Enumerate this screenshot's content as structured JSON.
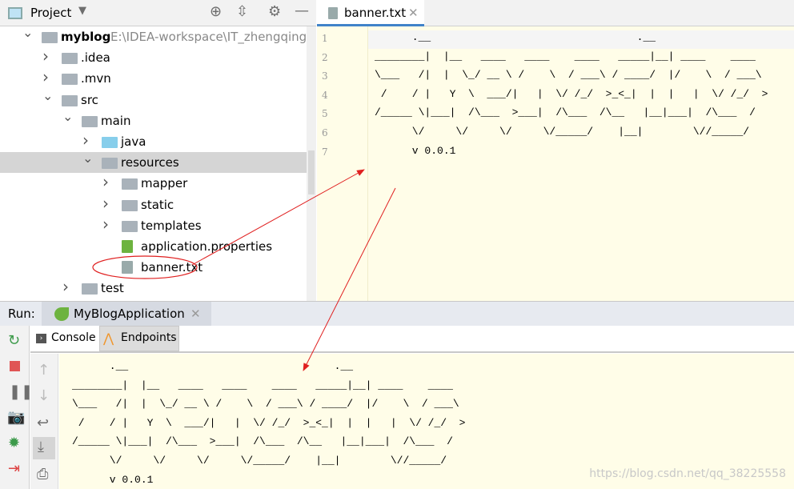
{
  "project_panel": {
    "title": "Project",
    "icons": [
      "project-view-icon",
      "chevron-down-icon",
      "locate-icon",
      "collapse-all-icon",
      "gear-icon",
      "minimize-icon"
    ]
  },
  "tree": [
    {
      "label": "myblog",
      "path": "E:\\IDEA-workspace\\IT_zhengqing\\test\\",
      "expanded": true
    },
    {
      "label": ".idea",
      "expanded": false
    },
    {
      "label": ".mvn",
      "expanded": false
    },
    {
      "label": "src",
      "expanded": true
    },
    {
      "label": "main",
      "expanded": true
    },
    {
      "label": "java",
      "expanded": false
    },
    {
      "label": "resources",
      "expanded": true,
      "selected": true
    },
    {
      "label": "mapper",
      "expanded": false
    },
    {
      "label": "static",
      "expanded": false
    },
    {
      "label": "templates",
      "expanded": false
    },
    {
      "label": "application.properties"
    },
    {
      "label": "banner.txt",
      "highlighted": true
    },
    {
      "label": "test",
      "expanded": false
    }
  ],
  "editor": {
    "tab": "banner.txt",
    "line_numbers": [
      "1",
      "2",
      "3",
      "4",
      "5",
      "6",
      "7"
    ],
    "lines": [
      "      .__                                 .__",
      "________|  |__   ____   ____    ____   _____|__| ____    ____",
      "\\___   /|  |  \\_/ __ \\ /    \\  / ___\\ / ____/  |/    \\  / ___\\",
      " /    / |   Y  \\  ___/|   |  \\/ /_/  >_<_|  |  |   |  \\/ /_/  >",
      "/_____ \\|___|  /\\___  >___|  /\\___  /\\__   |__|___|  /\\___  /",
      "      \\/     \\/     \\/     \\/_____/    |__|        \\//_____/",
      "      v 0.0.1"
    ]
  },
  "run": {
    "label": "Run:",
    "tab": "MyBlogApplication",
    "subtabs": [
      "Console",
      "Endpoints"
    ],
    "left_toolbar": [
      "rerun-icon",
      "stop-icon",
      "pause-icon",
      "camera-icon",
      "debug-icon",
      "exit-icon"
    ],
    "console_toolbar": [
      "up-arrow-icon",
      "down-arrow-icon",
      "soft-wrap-icon",
      "scroll-to-end-icon",
      "print-icon"
    ]
  },
  "watermark": "https://blog.csdn.net/qq_38225558",
  "colors": {
    "editor_bg": "#fffde8",
    "selection": "#d5d5d5",
    "annotation": "#e02020",
    "accent": "#4083c9"
  }
}
